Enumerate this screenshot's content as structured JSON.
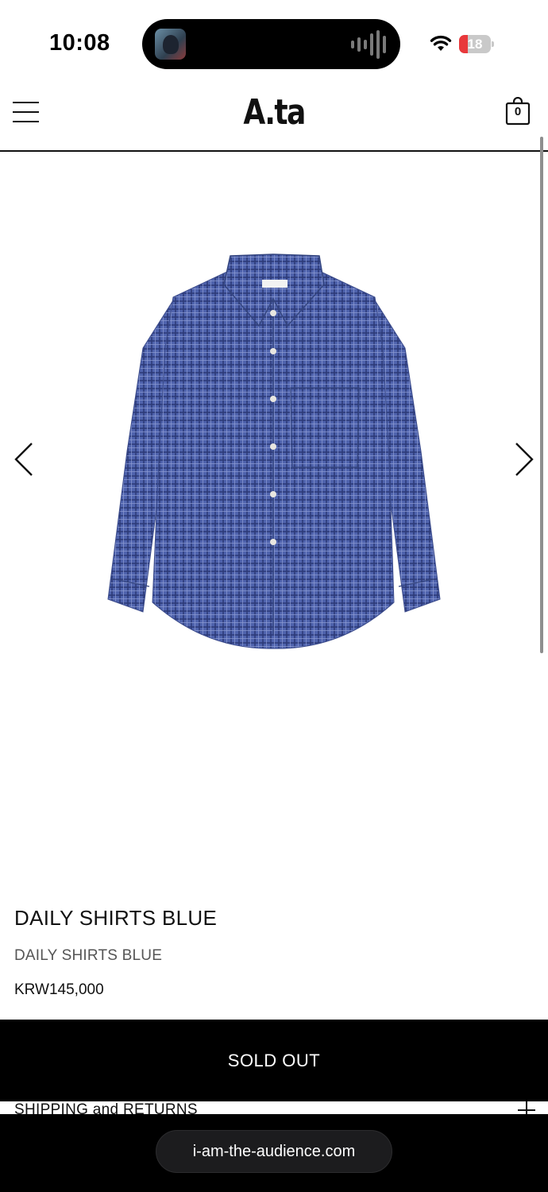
{
  "status_bar": {
    "time": "10:08",
    "battery_level": "18",
    "battery_fraction": 0.18,
    "battery_color": "#e8383b",
    "icons": [
      "now-playing-avatar-icon",
      "audio-waveform-icon",
      "wifi-icon",
      "battery-icon"
    ]
  },
  "header": {
    "brand": "A.ta",
    "cart_count": "0",
    "icons": [
      "hamburger-menu-icon",
      "shopping-bag-icon"
    ]
  },
  "gallery": {
    "image_subject": "blue-check-shirt",
    "shirt_label_text": "t.a",
    "icons": [
      "chevron-left-icon",
      "chevron-right-icon"
    ]
  },
  "product": {
    "title": "DAILY SHIRTS BLUE",
    "subtitle": "DAILY SHIRTS BLUE",
    "price": "KRW145,000"
  },
  "actions": {
    "sold_out_label": "SOLD OUT"
  },
  "accordion": {
    "shipping_label": "SHIPPING and RETURNS",
    "icon": "plus-icon"
  },
  "browser": {
    "url": "i-am-the-audience.com"
  },
  "colors": {
    "accent": "#000000",
    "shirt_blue": "#4a5fa8",
    "background": "#ffffff"
  }
}
